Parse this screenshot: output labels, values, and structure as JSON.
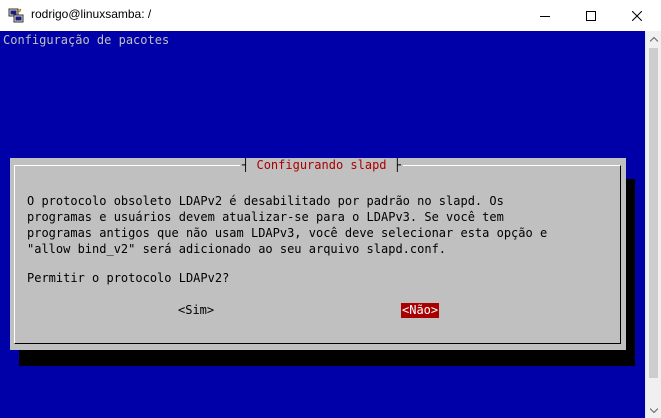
{
  "window": {
    "title": "rodrigo@linuxsamba: /",
    "controls": [
      "minimize",
      "maximize",
      "close"
    ]
  },
  "terminal": {
    "header": "Configuração de pacotes",
    "background": "#0000a8"
  },
  "dialog": {
    "title": "Configurando slapd",
    "title_left": "┤",
    "title_right": "├",
    "body_lines": [
      "O protocolo obsoleto LDAPv2 é desabilitado por padrão no slapd. Os",
      "programas e usuários devem atualizar-se para o LDAPv3. Se você tem",
      "programas antigos que não usam LDAPv3, você deve selecionar esta opção e",
      "\"allow bind_v2\" será adicionado ao seu arquivo slapd.conf."
    ],
    "question": "Permitir o protocolo LDAPv2?",
    "buttons": {
      "yes": "<Sim>",
      "no": "<Não>",
      "selected": "no"
    },
    "colors": {
      "background": "#c0c0c0",
      "title": "#a80000",
      "selected_button_bg": "#a80000",
      "selected_button_fg": "#ffffff"
    }
  }
}
